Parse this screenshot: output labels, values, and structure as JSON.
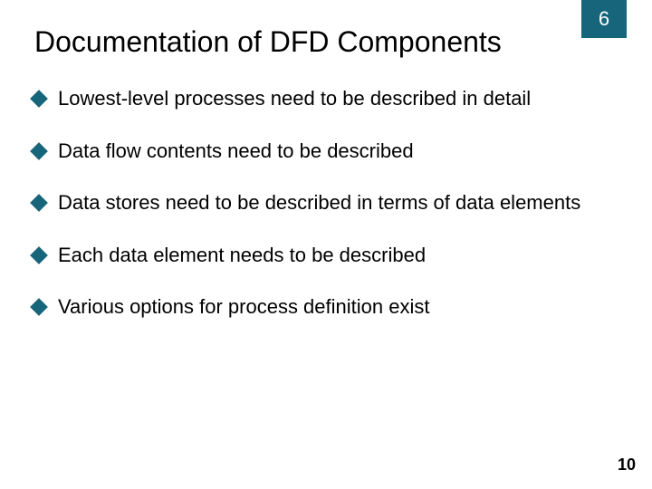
{
  "chapter": "6",
  "title": "Documentation of DFD Components",
  "bullets": [
    "Lowest-level processes need to be described in detail",
    "Data flow contents need to be described",
    "Data stores need to be described in terms of data elements",
    "Each data element needs to be described",
    "Various options for process definition exist"
  ],
  "page_number": "10",
  "accent_color": "#16657a"
}
